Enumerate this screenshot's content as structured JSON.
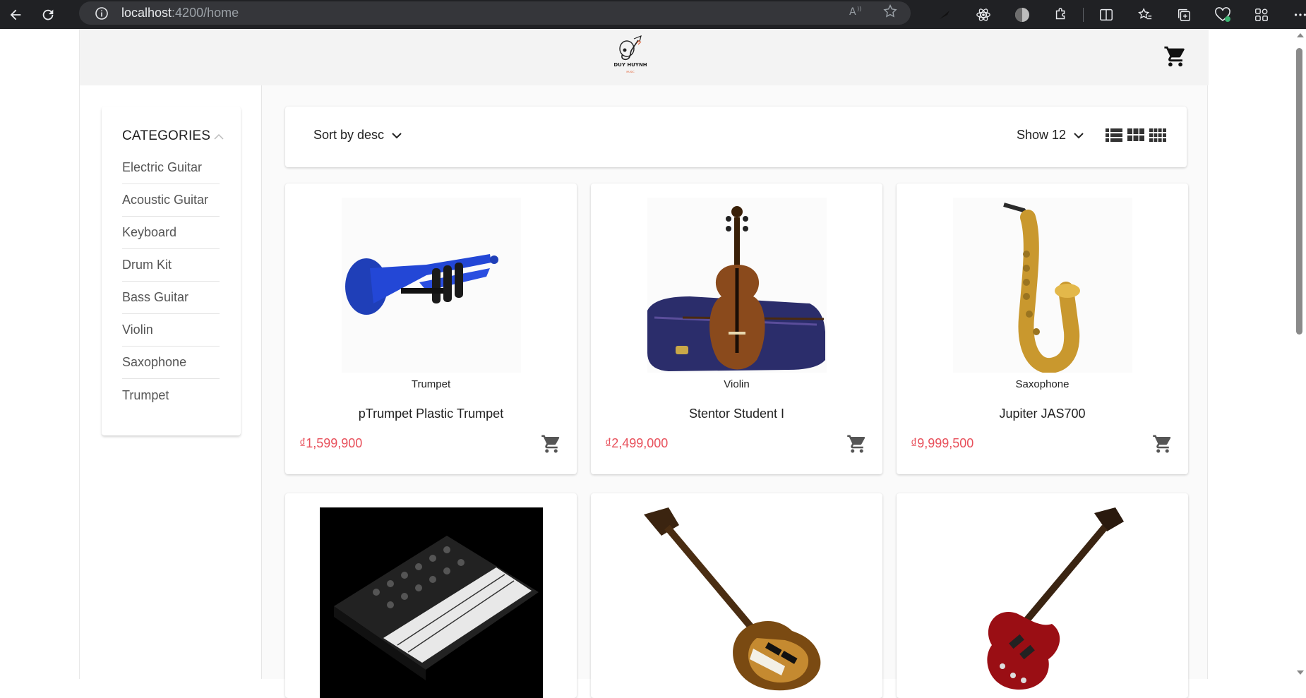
{
  "browser": {
    "url_host": "localhost",
    "url_path": ":4200/home",
    "icons": [
      "back-icon",
      "reload-icon",
      "info-icon",
      "read-aloud-icon",
      "favorite-star-icon",
      "extension-dark-icon",
      "react-devtools-icon",
      "profile-circle-icon",
      "extensions-puzzle-icon",
      "split-screen-icon",
      "favorites-icon",
      "collections-icon",
      "browser-essentials-icon",
      "sidebar-icon",
      "more-icon"
    ]
  },
  "header": {
    "logo_text": "DUY HUYNH",
    "logo_subtext": "MUSIC",
    "cart_icon": "shopping-cart-icon"
  },
  "sidebar": {
    "title": "CATEGORIES",
    "items": [
      {
        "label": "Electric Guitar"
      },
      {
        "label": "Acoustic Guitar"
      },
      {
        "label": "Keyboard"
      },
      {
        "label": "Drum Kit"
      },
      {
        "label": "Bass Guitar"
      },
      {
        "label": "Violin"
      },
      {
        "label": "Saxophone"
      },
      {
        "label": "Trumpet"
      }
    ]
  },
  "toolbar": {
    "sort_label": "Sort by desc",
    "show_label": "Show 12",
    "view_icons": [
      "list-view-icon",
      "grid-3-view-icon",
      "grid-4-view-icon"
    ]
  },
  "products": [
    {
      "category": "Trumpet",
      "name": "pTrumpet Plastic Trumpet",
      "price": "₫1,599,900",
      "image": "blue-trumpet"
    },
    {
      "category": "Violin",
      "name": "Stentor Student I",
      "price": "₫2,499,000",
      "image": "violin-with-case"
    },
    {
      "category": "Saxophone",
      "name": "Jupiter JAS700",
      "price": "₫9,999,500",
      "image": "gold-saxophone"
    },
    {
      "category": "",
      "name": "",
      "price": "",
      "image": "synthesizer-keyboard"
    },
    {
      "category": "",
      "name": "",
      "price": "",
      "image": "sunburst-bass-guitar"
    },
    {
      "category": "",
      "name": "",
      "price": "",
      "image": "red-electric-guitar"
    }
  ],
  "colors": {
    "price": "#e8505b",
    "chrome_bg": "#202124",
    "url_bar_bg": "#35363a"
  }
}
